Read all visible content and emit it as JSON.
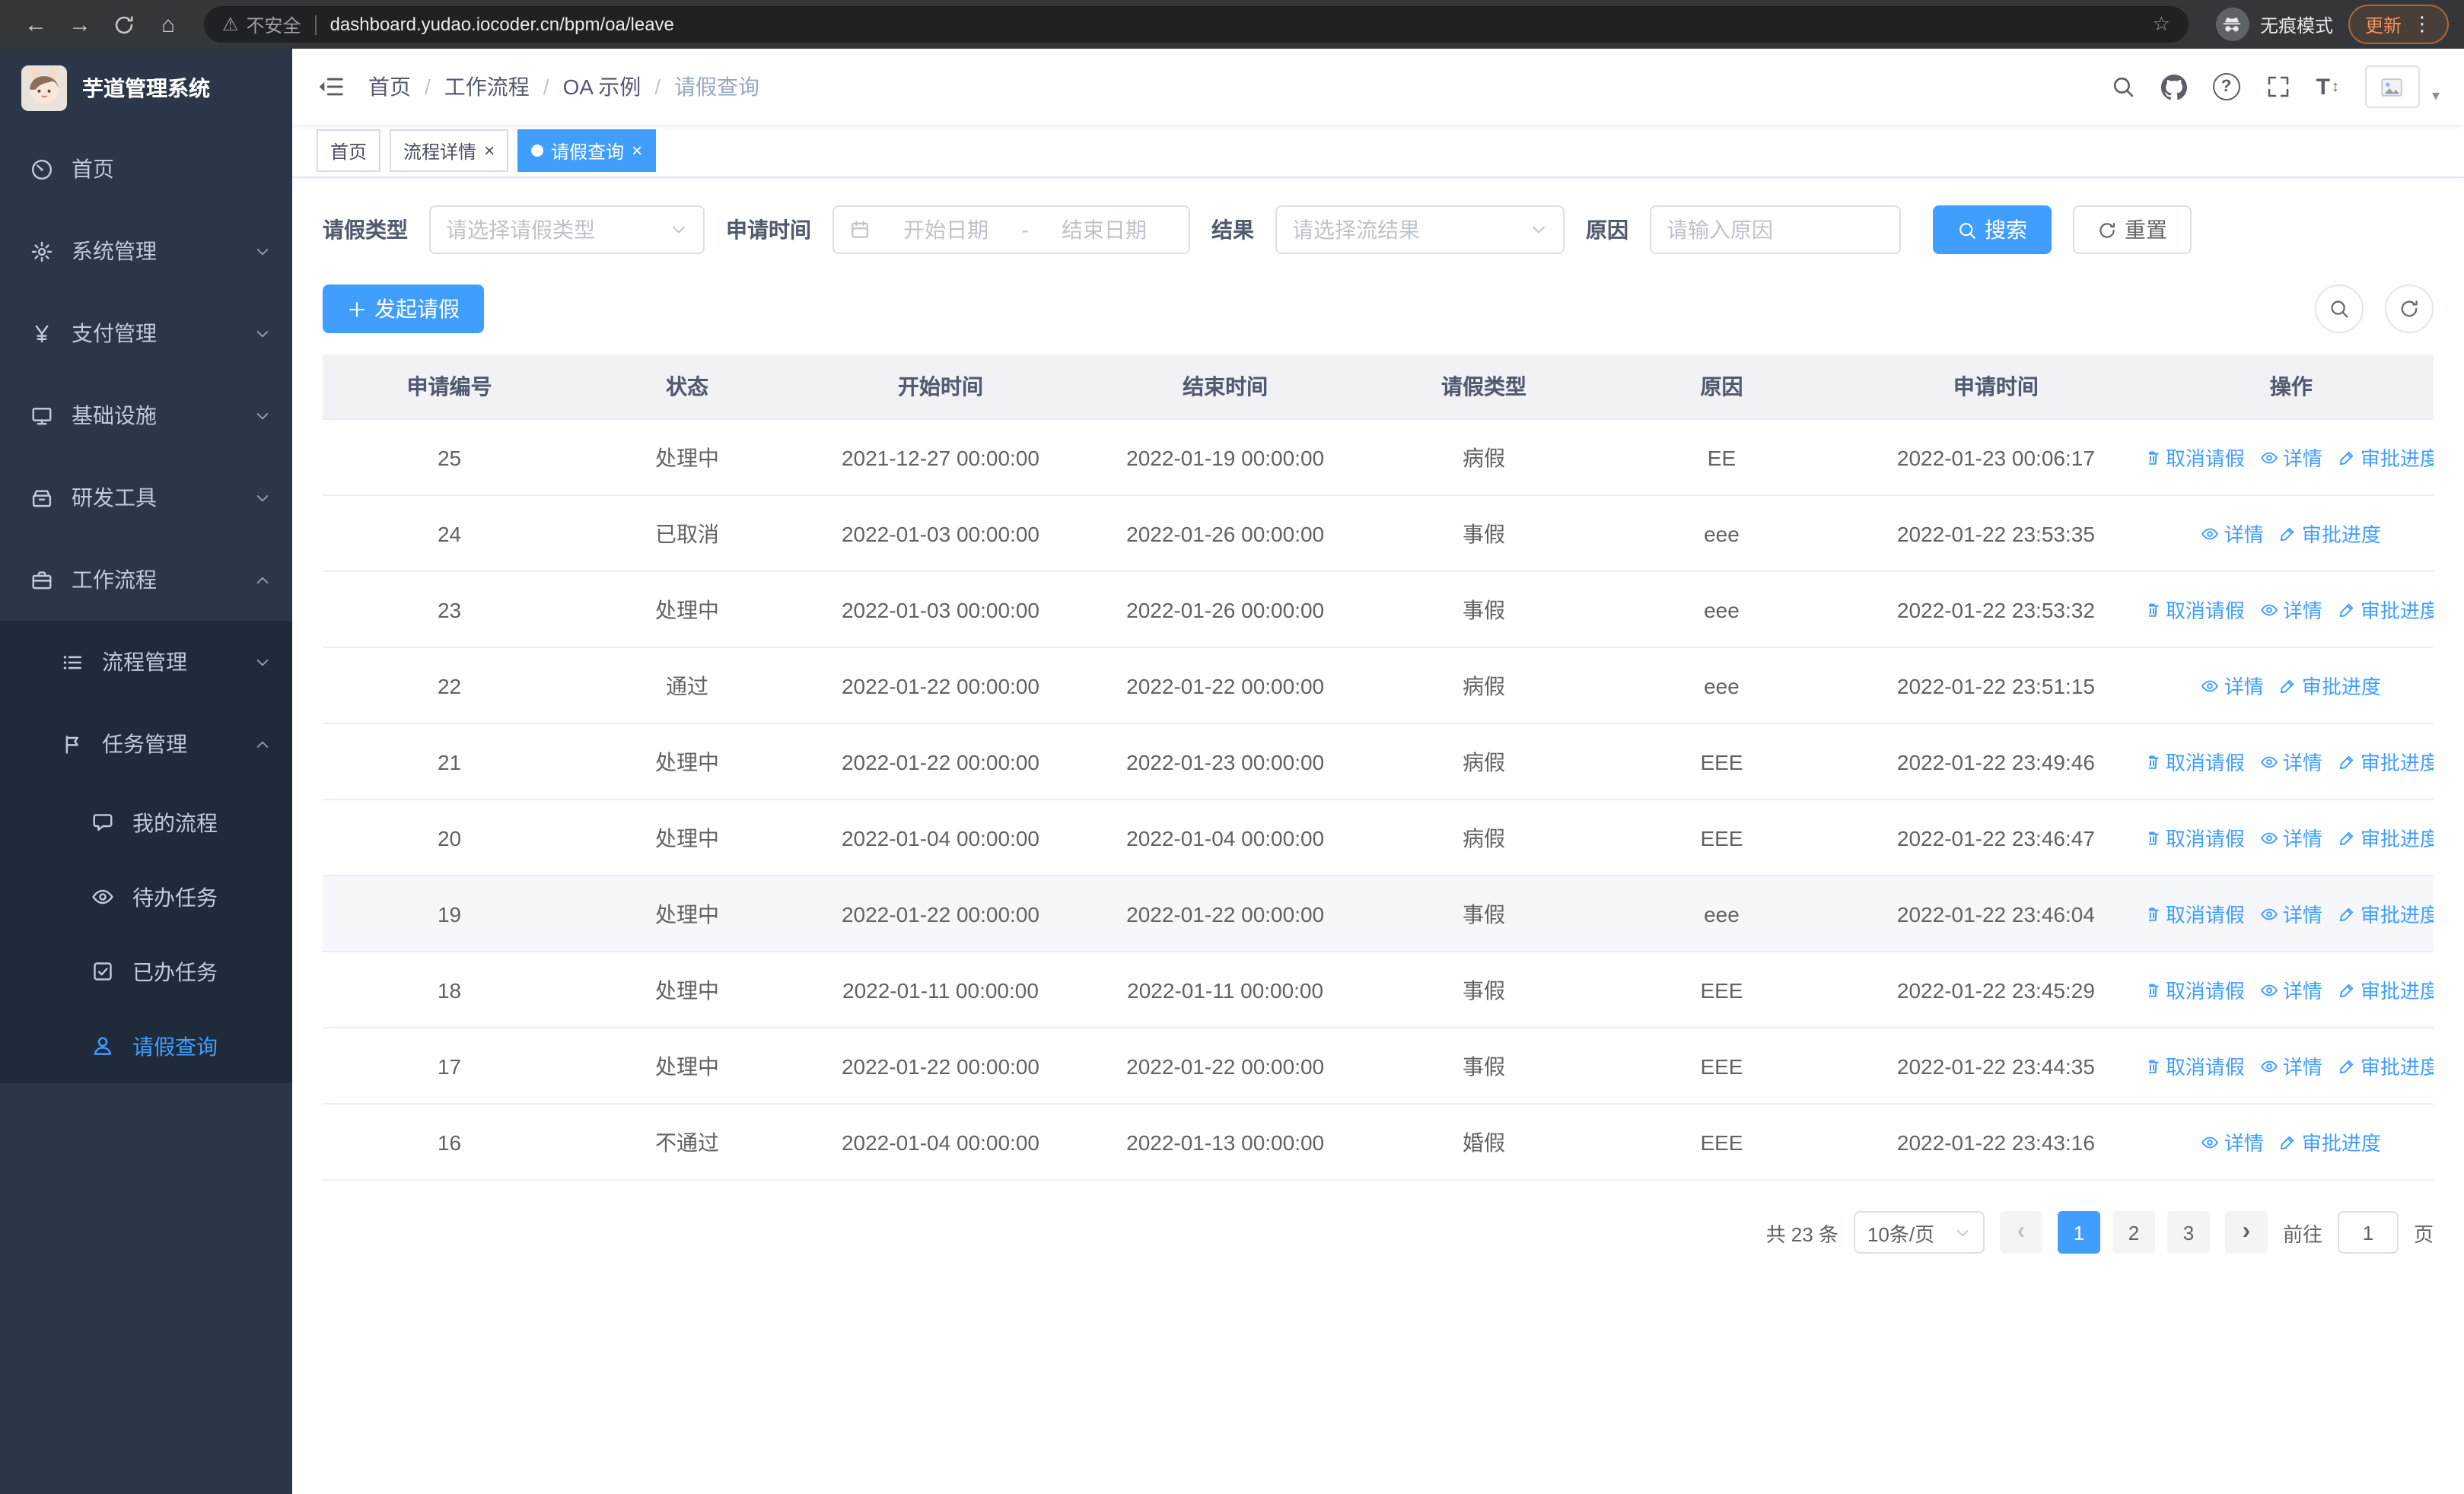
{
  "browser": {
    "security_label": "不安全",
    "url": "dashboard.yudao.iocoder.cn/bpm/oa/leave",
    "incognito_label": "无痕模式",
    "update_label": "更新"
  },
  "sidebar": {
    "app_title": "芋道管理系统",
    "menu": [
      {
        "label": "首页",
        "icon": "dashboard-icon",
        "level": 1
      },
      {
        "label": "系统管理",
        "icon": "gear-icon",
        "level": 1,
        "chevron": "down"
      },
      {
        "label": "支付管理",
        "icon": "yen-icon",
        "level": 1,
        "chevron": "down"
      },
      {
        "label": "基础设施",
        "icon": "infrastructure-icon",
        "level": 1,
        "chevron": "down"
      },
      {
        "label": "研发工具",
        "icon": "devtools-icon",
        "level": 1,
        "chevron": "down"
      },
      {
        "label": "工作流程",
        "icon": "workflow-icon",
        "level": 1,
        "chevron": "up"
      },
      {
        "label": "流程管理",
        "icon": "process-list-icon",
        "level": 2,
        "chevron": "down"
      },
      {
        "label": "任务管理",
        "icon": "task-flag-icon",
        "level": 2,
        "chevron": "up"
      },
      {
        "label": "我的流程",
        "icon": "chat-icon",
        "level": 3
      },
      {
        "label": "待办任务",
        "icon": "eye-icon",
        "level": 3
      },
      {
        "label": "已办任务",
        "icon": "done-check-icon",
        "level": 3
      },
      {
        "label": "请假查询",
        "icon": "user-icon",
        "level": 3,
        "active": true
      }
    ]
  },
  "header": {
    "breadcrumb": [
      "首页",
      "工作流程",
      "OA 示例",
      "请假查询"
    ]
  },
  "tags": [
    {
      "label": "首页",
      "closable": false,
      "active": false
    },
    {
      "label": "流程详情",
      "closable": true,
      "active": false
    },
    {
      "label": "请假查询",
      "closable": true,
      "active": true
    }
  ],
  "filters": {
    "leave_type_label": "请假类型",
    "leave_type_placeholder": "请选择请假类型",
    "apply_time_label": "申请时间",
    "start_date_placeholder": "开始日期",
    "range_separator": "-",
    "end_date_placeholder": "结束日期",
    "result_label": "结果",
    "result_placeholder": "请选择流结果",
    "reason_label": "原因",
    "reason_placeholder": "请输入原因",
    "search_label": "搜索",
    "reset_label": "重置"
  },
  "toolbar": {
    "create_label": "发起请假"
  },
  "table": {
    "columns": [
      "申请编号",
      "状态",
      "开始时间",
      "结束时间",
      "请假类型",
      "原因",
      "申请时间",
      "操作"
    ],
    "action_labels": {
      "cancel": "取消请假",
      "detail": "详情",
      "progress": "审批进度"
    },
    "action_icons": {
      "cancel": "trash-icon",
      "detail": "eye-icon",
      "progress": "edit-icon"
    },
    "rows": [
      {
        "id": "25",
        "status": "处理中",
        "start": "2021-12-27 00:00:00",
        "end": "2022-01-19 00:00:00",
        "type": "病假",
        "reason": "EE",
        "applied": "2022-01-23 00:06:17",
        "actions": [
          "cancel",
          "detail",
          "progress"
        ]
      },
      {
        "id": "24",
        "status": "已取消",
        "start": "2022-01-03 00:00:00",
        "end": "2022-01-26 00:00:00",
        "type": "事假",
        "reason": "eee",
        "applied": "2022-01-22 23:53:35",
        "actions": [
          "detail",
          "progress"
        ]
      },
      {
        "id": "23",
        "status": "处理中",
        "start": "2022-01-03 00:00:00",
        "end": "2022-01-26 00:00:00",
        "type": "事假",
        "reason": "eee",
        "applied": "2022-01-22 23:53:32",
        "actions": [
          "cancel",
          "detail",
          "progress"
        ]
      },
      {
        "id": "22",
        "status": "通过",
        "start": "2022-01-22 00:00:00",
        "end": "2022-01-22 00:00:00",
        "type": "病假",
        "reason": "eee",
        "applied": "2022-01-22 23:51:15",
        "actions": [
          "detail",
          "progress"
        ]
      },
      {
        "id": "21",
        "status": "处理中",
        "start": "2022-01-22 00:00:00",
        "end": "2022-01-23 00:00:00",
        "type": "病假",
        "reason": "EEE",
        "applied": "2022-01-22 23:49:46",
        "actions": [
          "cancel",
          "detail",
          "progress"
        ]
      },
      {
        "id": "20",
        "status": "处理中",
        "start": "2022-01-04 00:00:00",
        "end": "2022-01-04 00:00:00",
        "type": "病假",
        "reason": "EEE",
        "applied": "2022-01-22 23:46:47",
        "actions": [
          "cancel",
          "detail",
          "progress"
        ]
      },
      {
        "id": "19",
        "status": "处理中",
        "start": "2022-01-22 00:00:00",
        "end": "2022-01-22 00:00:00",
        "type": "事假",
        "reason": "eee",
        "applied": "2022-01-22 23:46:04",
        "actions": [
          "cancel",
          "detail",
          "progress"
        ],
        "highlight": true
      },
      {
        "id": "18",
        "status": "处理中",
        "start": "2022-01-11 00:00:00",
        "end": "2022-01-11 00:00:00",
        "type": "事假",
        "reason": "EEE",
        "applied": "2022-01-22 23:45:29",
        "actions": [
          "cancel",
          "detail",
          "progress"
        ]
      },
      {
        "id": "17",
        "status": "处理中",
        "start": "2022-01-22 00:00:00",
        "end": "2022-01-22 00:00:00",
        "type": "事假",
        "reason": "EEE",
        "applied": "2022-01-22 23:44:35",
        "actions": [
          "cancel",
          "detail",
          "progress"
        ]
      },
      {
        "id": "16",
        "status": "不通过",
        "start": "2022-01-04 00:00:00",
        "end": "2022-01-13 00:00:00",
        "type": "婚假",
        "reason": "EEE",
        "applied": "2022-01-22 23:43:16",
        "actions": [
          "detail",
          "progress"
        ]
      }
    ]
  },
  "pagination": {
    "total_label": "共 23 条",
    "page_size_label": "10条/页",
    "pages": [
      "1",
      "2",
      "3"
    ],
    "active_page": "1",
    "prev_symbol": "‹",
    "next_symbol": "›",
    "goto_label": "前往",
    "goto_value": "1",
    "unit_label": "页"
  },
  "colors": {
    "primary": "#409eff",
    "sidebar_bg": "#2b3648",
    "sidebar_sub_bg": "#1f2b3b",
    "table_header_bg": "#f0f2f5"
  }
}
